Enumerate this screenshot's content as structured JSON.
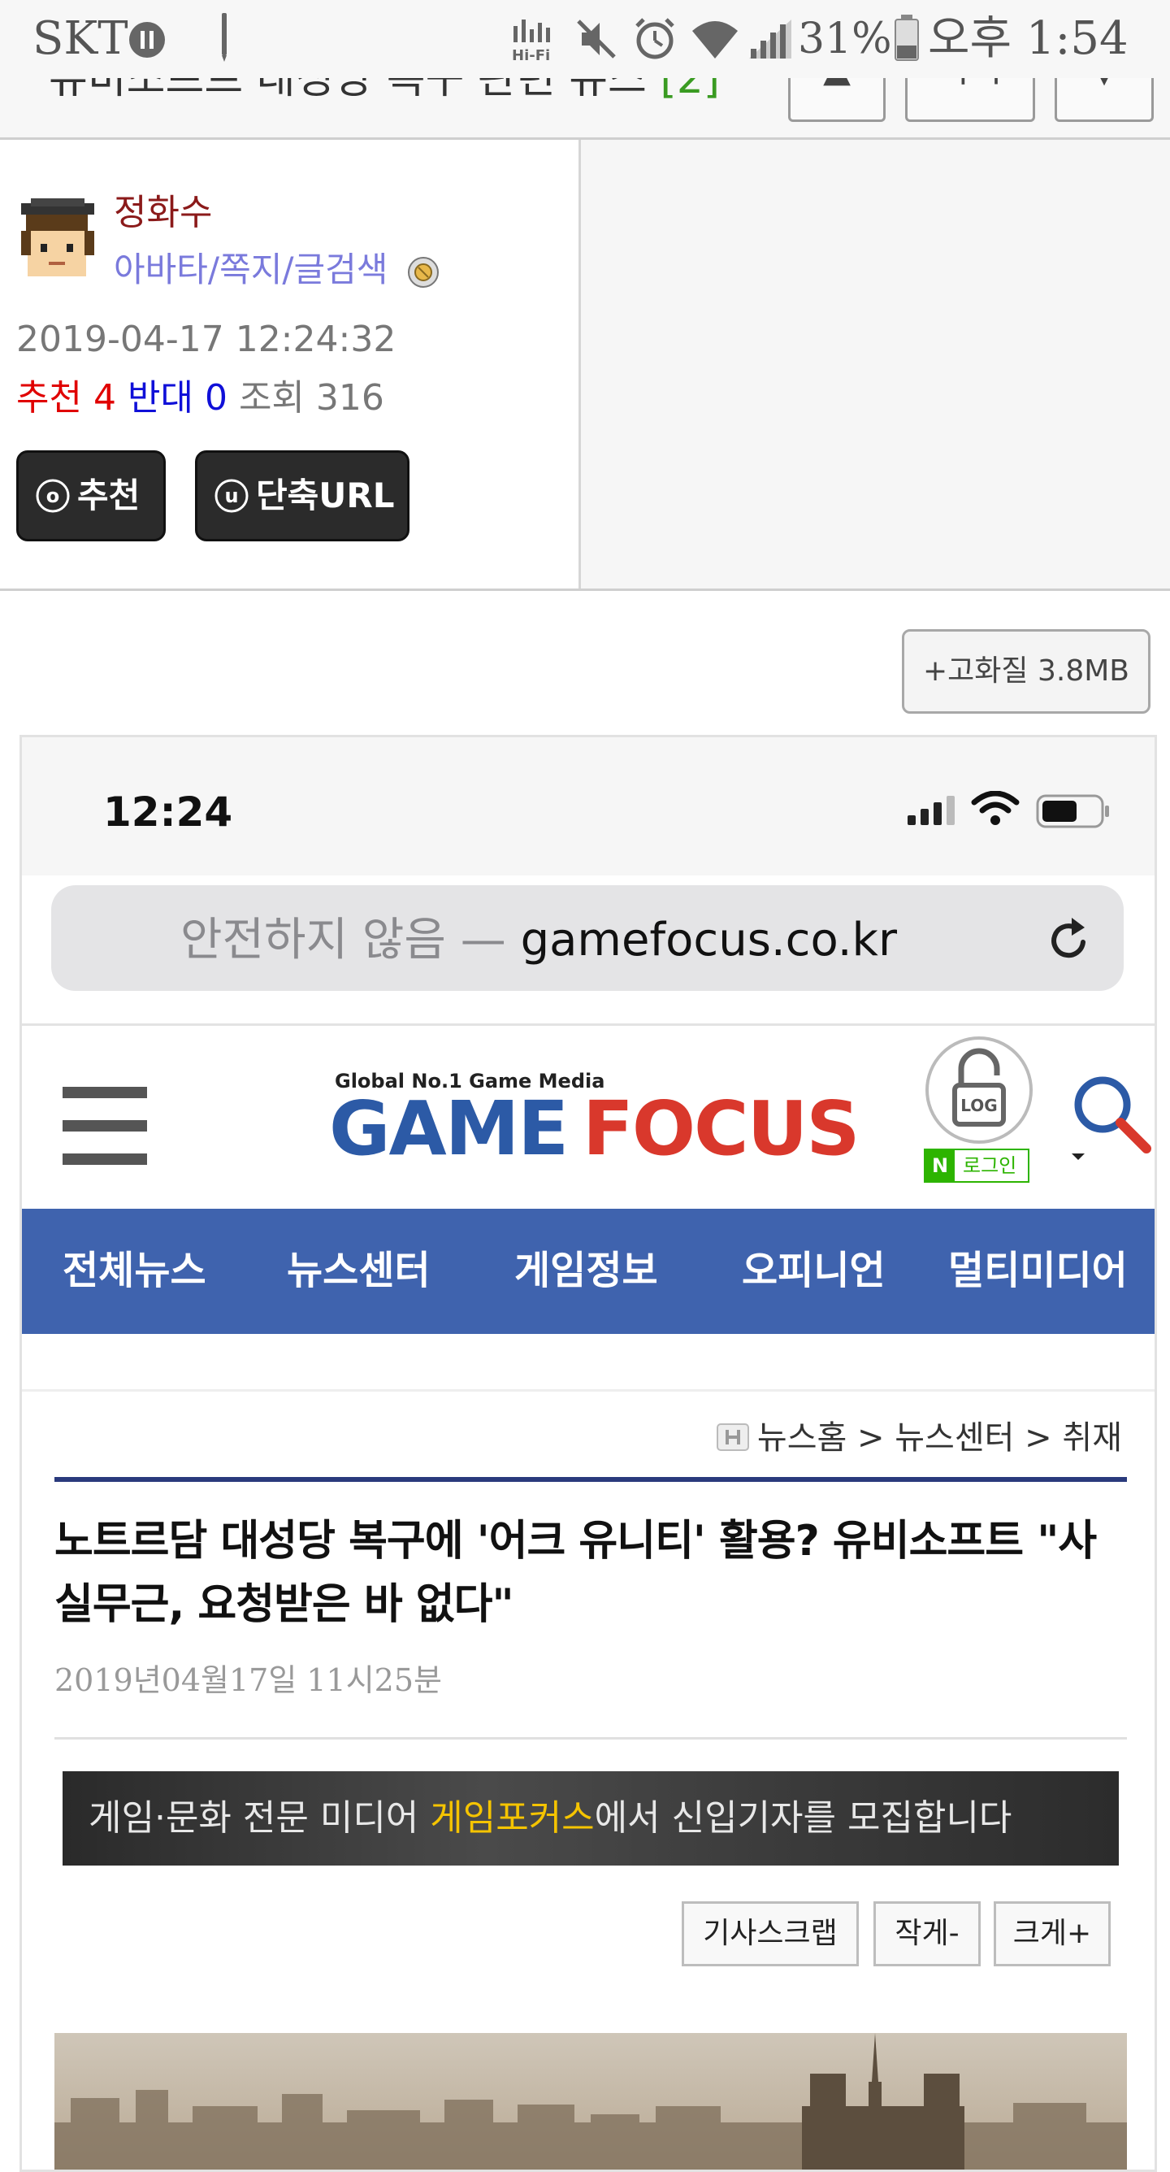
{
  "status_bar": {
    "carrier": "SKT",
    "battery_percent": "31%",
    "time": "오후 1:54",
    "icons": [
      "pause-icon",
      "pen-icon",
      "hifi-icon",
      "mute-icon",
      "alarm-icon",
      "wifi-icon",
      "signal-icon",
      "battery-icon"
    ]
  },
  "page_header": {
    "title": "유비소프트 대성당 복구 관련 뉴스",
    "comment_count": "[2]",
    "up_glyph": "▲",
    "list_label": "목록",
    "more_glyph": "▼"
  },
  "author": {
    "name": "정화수",
    "links": "아바타/쪽지/글검색",
    "datetime": "2019-04-17 12:24:32",
    "recommend_label": "추천",
    "recommend_count": "4",
    "oppose_label": "반대",
    "oppose_count": "0",
    "views_label": "조회",
    "views_count": "316"
  },
  "actions": {
    "recommend_button": "추천",
    "short_url_button": "단축URL",
    "recommend_icon_letter": "o",
    "short_url_icon_letter": "u"
  },
  "hq_button": "+고화질 3.8MB",
  "embedded": {
    "ios_time": "12:24",
    "url_insecure": "안전하지 않음 —",
    "url_domain": "gamefocus.co.kr",
    "logo_tagline": "Global No.1 Game Media",
    "logo_game": "GAME",
    "logo_focus": "FOCUS",
    "login_lock_text": "LOG",
    "naver_mark": "N",
    "naver_login": "로그인",
    "nav": [
      "전체뉴스",
      "뉴스센터",
      "게임정보",
      "오피니언",
      "멀티미디어"
    ],
    "breadcrumb": "뉴스홈 > 뉴스센터 > 취재",
    "article_title": "노트르담 대성당 복구에 '어크 유니티' 활용? 유비소프트 \"사실무근, 요청받은 바 없다\"",
    "article_date": "2019년04월17일 11시25분",
    "banner_prefix": "게임·문화 전문 미디어 ",
    "banner_highlight": "게임포커스",
    "banner_suffix": "에서 신입기자를 모집합니다",
    "tools": {
      "scrap": "기사스크랩",
      "smaller": "작게-",
      "bigger": "크게+"
    }
  },
  "colors": {
    "nav_bg": "#3f63ae",
    "logo_blue": "#2c5aa6",
    "logo_red": "#d9382c",
    "author_name": "#8b1a1a",
    "author_links": "#7a7adc",
    "stat_red": "#e00000",
    "stat_blue": "#1010d8",
    "banner_highlight": "#f5c400",
    "naver_green": "#2db400"
  }
}
